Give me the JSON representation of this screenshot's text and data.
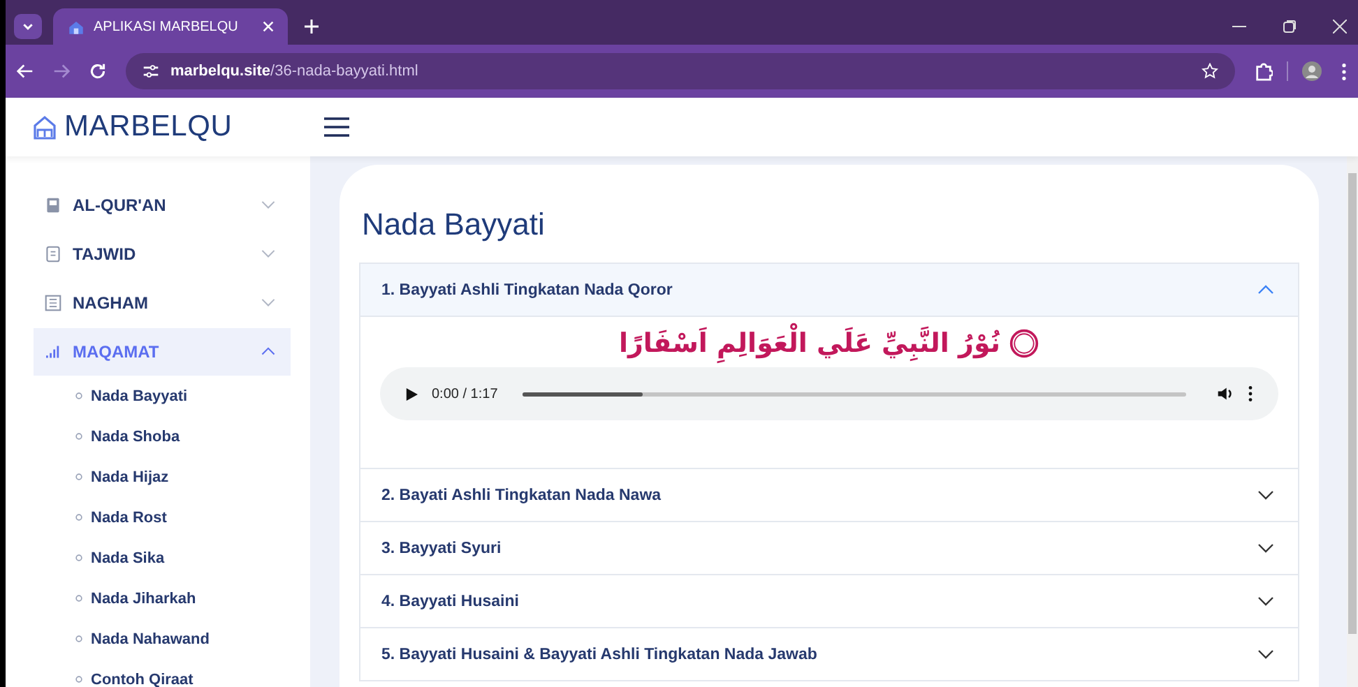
{
  "browser": {
    "tab_title": "APLIKASI MARBELQU",
    "url_host": "marbelqu.site",
    "url_path": "/36-nada-bayyati.html"
  },
  "header": {
    "logo_text": "MARBELQU"
  },
  "sidebar": {
    "items": [
      {
        "label": "AL-QUR'AN",
        "expanded": false,
        "selected": false
      },
      {
        "label": "TAJWID",
        "expanded": false,
        "selected": false
      },
      {
        "label": "NAGHAM",
        "expanded": false,
        "selected": false
      },
      {
        "label": "MAQAMAT",
        "expanded": true,
        "selected": true,
        "children": [
          {
            "label": "Nada Bayyati"
          },
          {
            "label": "Nada Shoba"
          },
          {
            "label": "Nada Hijaz"
          },
          {
            "label": "Nada Rost"
          },
          {
            "label": "Nada Sika"
          },
          {
            "label": "Nada Jiharkah"
          },
          {
            "label": "Nada Nahawand"
          },
          {
            "label": "Contoh Qiraat"
          }
        ]
      }
    ]
  },
  "main": {
    "title": "Nada Bayyati",
    "accordion": [
      {
        "title": "1. Bayyati Ashli Tingkatan Nada Qoror",
        "expanded": true,
        "arabic": "نُوْرُ النَّبِيِّ عَلَي الْعَوَالِمِ اَسْفَارًا",
        "audio": {
          "time": "0:00 / 1:17",
          "level": 0.18
        }
      },
      {
        "title": "2. Bayati Ashli Tingkatan Nada Nawa",
        "expanded": false
      },
      {
        "title": "3. Bayyati Syuri",
        "expanded": false
      },
      {
        "title": "4. Bayyati Husaini",
        "expanded": false
      },
      {
        "title": "5. Bayyati Husaini & Bayyati Ashli Tingkatan Nada Jawab",
        "expanded": false
      }
    ]
  }
}
